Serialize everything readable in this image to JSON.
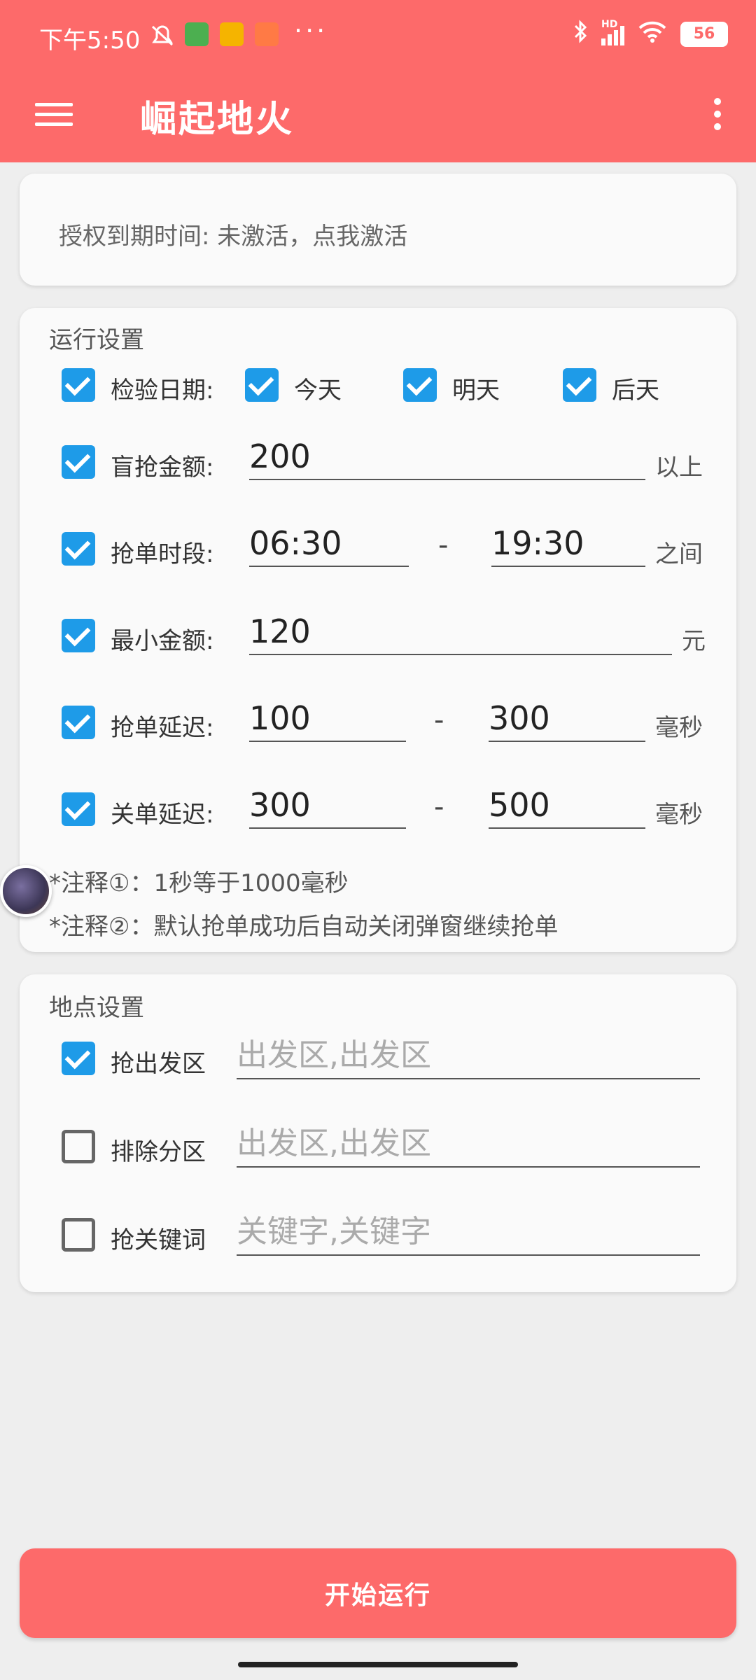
{
  "status_bar": {
    "time": "下午5:50",
    "battery": "56",
    "network": "HD"
  },
  "app_bar": {
    "title": "崛起地火"
  },
  "auth_card": {
    "text": "授权到期时间:  未激活，点我激活"
  },
  "run_settings": {
    "title": "运行设置",
    "check_date": {
      "label": "检验日期:",
      "today": "今天",
      "tomorrow": "明天",
      "day_after": "后天"
    },
    "blind_amount": {
      "label": "盲抢金额:",
      "value": "200",
      "unit": "以上"
    },
    "time_period": {
      "label": "抢单时段:",
      "from": "06:30",
      "to": "19:30",
      "unit": "之间",
      "sep": "-"
    },
    "min_amount": {
      "label": "最小金额:",
      "value": "120",
      "unit": "元"
    },
    "grab_delay": {
      "label": "抢单延迟:",
      "from": "100",
      "to": "300",
      "unit": "毫秒",
      "sep": "-"
    },
    "close_delay": {
      "label": "关单延迟:",
      "from": "300",
      "to": "500",
      "unit": "毫秒",
      "sep": "-"
    },
    "note1": "*注释①：1秒等于1000毫秒",
    "note2": "*注释②：默认抢单成功后自动关闭弹窗继续抢单"
  },
  "location_settings": {
    "title": "地点设置",
    "grab_departure": {
      "label": "抢出发区",
      "placeholder": "出发区,出发区"
    },
    "exclude_zone": {
      "label": "排除分区",
      "placeholder": "出发区,出发区"
    },
    "grab_keyword": {
      "label": "抢关键词",
      "placeholder": "关键字,关键字"
    }
  },
  "start_button": "开始运行",
  "colors": {
    "accent": "#fd6a6a",
    "checkbox": "#1e9be8"
  }
}
